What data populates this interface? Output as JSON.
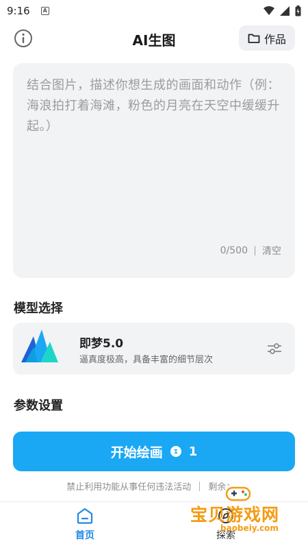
{
  "status_bar": {
    "time": "9:16",
    "notif_letter": "A"
  },
  "header": {
    "title": "AI生图",
    "works_label": "作品"
  },
  "prompt": {
    "placeholder": "结合图片，描述你想生成的画面和动作（例：海浪拍打着海滩，粉色的月亮在天空中缓缓升起。）",
    "counter": "0/500",
    "clear_label": "清空"
  },
  "model_section": {
    "title": "模型选择",
    "model": {
      "name": "即梦5.0",
      "description": "逼真度极高，具备丰富的细节层次"
    }
  },
  "params_section": {
    "title": "参数设置"
  },
  "start_button": {
    "label": "开始绘画",
    "credits": "1"
  },
  "notice": {
    "text": "禁止利用功能从事任何违法活动",
    "remaining": "剩余：--"
  },
  "bottom_nav": [
    {
      "label": "首页",
      "icon": "home-icon",
      "active": true
    },
    {
      "label": "探索",
      "icon": "explore-icon",
      "active": false
    }
  ],
  "watermark": {
    "title": "宝贝游戏网",
    "url": "baobeiy.com"
  },
  "colors": {
    "accent": "#1aa8f5",
    "nav_active": "#1e88e5",
    "panel": "#f2f3f5",
    "watermark": "#f39c12"
  }
}
